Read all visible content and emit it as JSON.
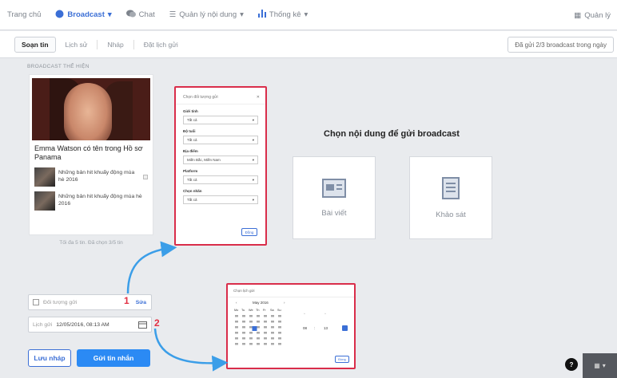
{
  "topnav": {
    "items": [
      {
        "label": "Trang chủ",
        "active": false
      },
      {
        "label": "Broadcast",
        "active": true
      },
      {
        "label": "Chat",
        "active": false
      },
      {
        "label": "Quản lý nội dung",
        "active": false
      },
      {
        "label": "Thống kê",
        "active": false
      }
    ],
    "right_label": "Quản lý"
  },
  "subtabs": [
    "Soạn tin",
    "Lịch sử",
    "Nháp",
    "Đặt lịch gửi"
  ],
  "sent_status": "Đã gửi 2/3 broadcast trong ngày",
  "preview": {
    "section_title": "BROADCAST THỂ HIỆN",
    "headline": "Emma Watson có tên trong Hồ sơ Panama",
    "items": [
      "Những bản hit khuấy động mùa hè 2016",
      "Những bản hit khuấy động mùa hè 2016"
    ],
    "hint": "Tối đa 5 tin. Đã chọn 3/5 tin"
  },
  "options": {
    "targeting_label": "Đối tượng gửi",
    "targeting_link": "Sửa",
    "schedule_label": "Lịch gửi",
    "schedule_value": "12/05/2016, 08:13 AM"
  },
  "callouts": [
    "1",
    "2"
  ],
  "buttons": {
    "draft": "Lưu nháp",
    "send": "Gửi tin nhắn"
  },
  "main": {
    "title": "Chọn nội dung để gửi broadcast",
    "choices": [
      {
        "label": "Bài viết",
        "icon": "article-icon"
      },
      {
        "label": "Khảo sát",
        "icon": "survey-icon"
      }
    ]
  },
  "popup_target": {
    "title": "Chọn đối tượng gửi",
    "groups": [
      {
        "label": "Giới tính",
        "value": "Tất cả"
      },
      {
        "label": "Độ tuổi",
        "value": "Tất cả"
      },
      {
        "label": "Địa điểm",
        "value": "Miền Bắc, Miền Nam"
      },
      {
        "label": "Platform",
        "value": "Tất cả"
      },
      {
        "label": "Chọn nhãn",
        "value": "Tất cả"
      }
    ],
    "ok": "Đồng"
  },
  "popup_schedule": {
    "title": "Chọn lịch gửi",
    "month": "May 2016",
    "weekdays": [
      "Mo",
      "Tu",
      "We",
      "Th",
      "Fr",
      "Sa",
      "Su"
    ],
    "selected_day": "12",
    "ok": "Đồng"
  },
  "help_label": "?",
  "colors": {
    "accent": "#2b8af4",
    "callout": "#d92d4a",
    "arrow": "#3b9ee8"
  }
}
